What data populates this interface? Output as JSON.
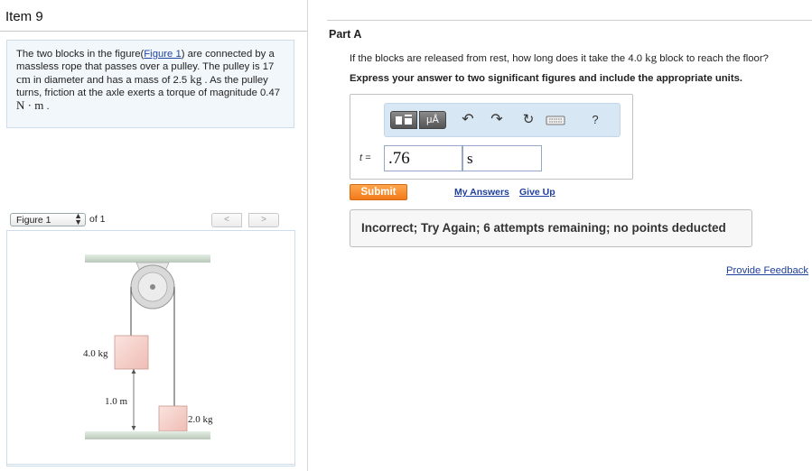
{
  "item": {
    "title": "Item 9"
  },
  "problem": {
    "text_1": "The two blocks in the figure(",
    "figure_link": "Figure 1",
    "text_2": ") are connected by a massless rope that passes over a pulley. The pulley is 17 ",
    "unit_cm": "cm",
    "text_3": " in diameter and has a mass of 2.5 ",
    "unit_kg": "kg",
    "text_4": " . As the pulley turns, friction at the axle exerts a torque of magnitude 0.47 ",
    "unit_nm": "N · m",
    "text_5": " ."
  },
  "figure_nav": {
    "selected": "Figure 1",
    "of_label": "of 1",
    "prev_glyph": "<",
    "next_glyph": ">"
  },
  "figure": {
    "mass_top": "4.0 kg",
    "mass_bottom": "2.0 kg",
    "height_label": "1.0 m"
  },
  "part": {
    "title": "Part A",
    "question_1": "If the blocks are released from rest, how long does it take the 4.0 ",
    "question_unit": "kg",
    "question_2": " block to reach the floor?",
    "instructions": "Express your answer to two significant figures and include the appropriate units."
  },
  "answer": {
    "variable": "t =",
    "value": ".76",
    "unit": "s",
    "toolbar": {
      "templates_icon": "templates-icon",
      "units_label": "μÅ",
      "undo_glyph": "↶",
      "redo_glyph": "↷",
      "reset_glyph": "↻",
      "help_glyph": "?"
    }
  },
  "actions": {
    "submit": "Submit",
    "my_answers": "My Answers",
    "give_up": "Give Up"
  },
  "feedback": {
    "message": "Incorrect; Try Again; 6 attempts remaining; no points deducted",
    "provide_feedback": "Provide Feedback"
  },
  "colors": {
    "accent_orange": "#f27a1a",
    "link_blue": "#1f3f9c",
    "panel_blue": "#d8e7f4"
  }
}
